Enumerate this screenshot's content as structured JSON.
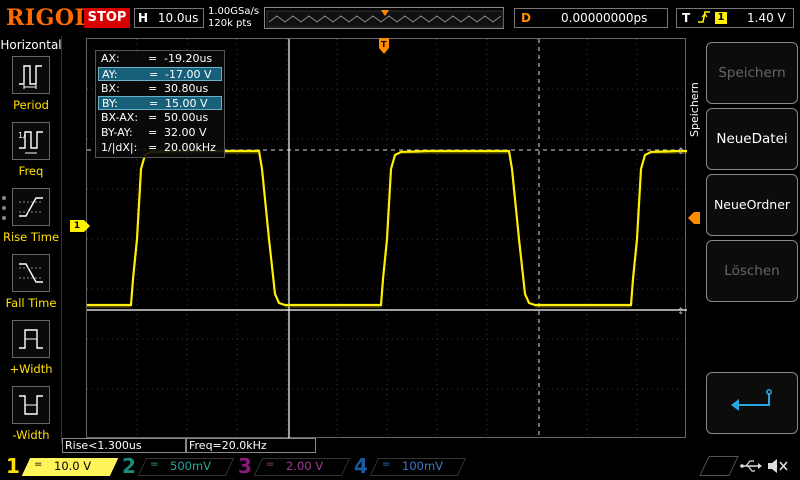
{
  "header": {
    "brand": "RIGOL",
    "run_state": "STOP",
    "horizontal": {
      "key": "H",
      "value": "10.0us"
    },
    "sample_rate": "1.00GSa/s",
    "memory_depth": "120k pts",
    "delay": {
      "key": "D",
      "value": "0.00000000ps"
    },
    "trigger": {
      "key": "T",
      "edge": "rising-edge-icon",
      "source": "1",
      "level": "1.40 V"
    }
  },
  "left_menu": {
    "title": "Horizontal",
    "items": [
      {
        "label": "Period",
        "icon": "period-icon"
      },
      {
        "label": "Freq",
        "icon": "frequency-icon"
      },
      {
        "label": "Rise Time",
        "icon": "rise-time-icon"
      },
      {
        "label": "Fall Time",
        "icon": "fall-time-icon"
      },
      {
        "label": "+Width",
        "icon": "positive-width-icon"
      },
      {
        "label": "-Width",
        "icon": "negative-width-icon"
      }
    ]
  },
  "cursor_readout": [
    {
      "name": "AX:",
      "eq": "=",
      "value": "-19.20us",
      "selected": false
    },
    {
      "name": "AY:",
      "eq": "=",
      "value": "-17.00 V",
      "selected": true
    },
    {
      "name": "BX:",
      "eq": "=",
      "value": "30.80us",
      "selected": false
    },
    {
      "name": "BY:",
      "eq": "=",
      "value": "15.00 V",
      "selected": true
    },
    {
      "name": "BX-AX:",
      "eq": "=",
      "value": "50.00us",
      "selected": false
    },
    {
      "name": "BY-AY:",
      "eq": "=",
      "value": "32.00 V",
      "selected": false
    },
    {
      "name": "1/|dX|:",
      "eq": "=",
      "value": "20.00kHz",
      "selected": false
    }
  ],
  "channel_marker": "1",
  "right_menu": {
    "title": "Speichern",
    "buttons": [
      {
        "label": "Speichern",
        "enabled": false
      },
      {
        "label": "NeueDatei",
        "enabled": true
      },
      {
        "label": "NeueOrdner",
        "enabled": true
      },
      {
        "label": "Löschen",
        "enabled": false
      }
    ],
    "back_icon": "return-arrow-icon"
  },
  "measurements": [
    {
      "text": "Rise<1.300us"
    },
    {
      "text": "Freq=20.0kHz"
    }
  ],
  "channels": [
    {
      "num": "1",
      "coupling": "=",
      "scale": "10.0 V",
      "active": true
    },
    {
      "num": "2",
      "coupling": "=",
      "scale": "500mV",
      "active": false
    },
    {
      "num": "3",
      "coupling": "=",
      "scale": "2.00 V",
      "active": false
    },
    {
      "num": "4",
      "coupling": "=",
      "scale": "100mV",
      "active": false
    }
  ],
  "status_icons": [
    "usb-icon",
    "speaker-muted-icon"
  ],
  "colors": {
    "ch1": "#ffef00",
    "ch2": "#2aa696",
    "ch3": "#a43c94",
    "ch4": "#3c78c0",
    "brand": "#ff6a00",
    "stop": "#d80000",
    "selection": "#17607a"
  }
}
